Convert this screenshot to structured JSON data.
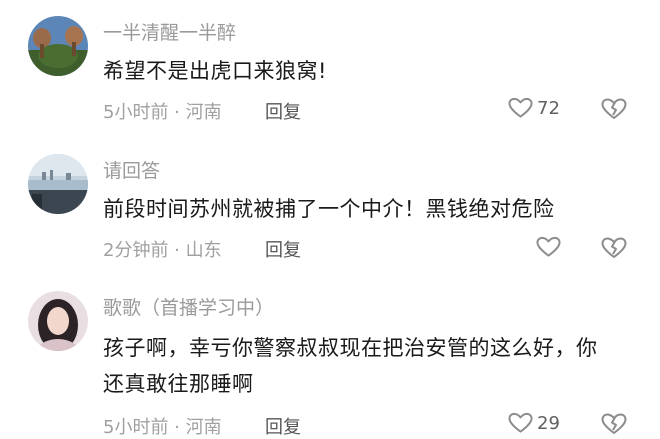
{
  "comments": [
    {
      "username": "一半清醒一半醉",
      "content": "希望不是出虎口来狼窝!",
      "time": "5小时前",
      "sep": " · ",
      "location": "河南",
      "reply_label": "回复",
      "like_count": "72",
      "avatar_icon": "avatar-flowers-icon"
    },
    {
      "username": "请回答",
      "content": "前段时间苏州就被捕了一个中介！黑钱绝对危险",
      "time": "2分钟前",
      "sep": " · ",
      "location": "山东",
      "reply_label": "回复",
      "like_count": "",
      "avatar_icon": "avatar-cityscape-icon"
    },
    {
      "username": "歌歌（首播学习中）",
      "content": "孩子啊，幸亏你警察叔叔现在把治安管的这么好，你还真敢往那睡啊",
      "time": "5小时前",
      "sep": " · ",
      "location": "河南",
      "reply_label": "回复",
      "like_count": "29",
      "avatar_icon": "avatar-person-icon"
    }
  ],
  "icons": {
    "like": "heart-outline-icon",
    "dislike": "broken-heart-icon"
  },
  "colors": {
    "username": "#9a9a9a",
    "content": "#1a1a1a",
    "meta": "#a0a0a0",
    "icon": "#8c8c8c"
  }
}
